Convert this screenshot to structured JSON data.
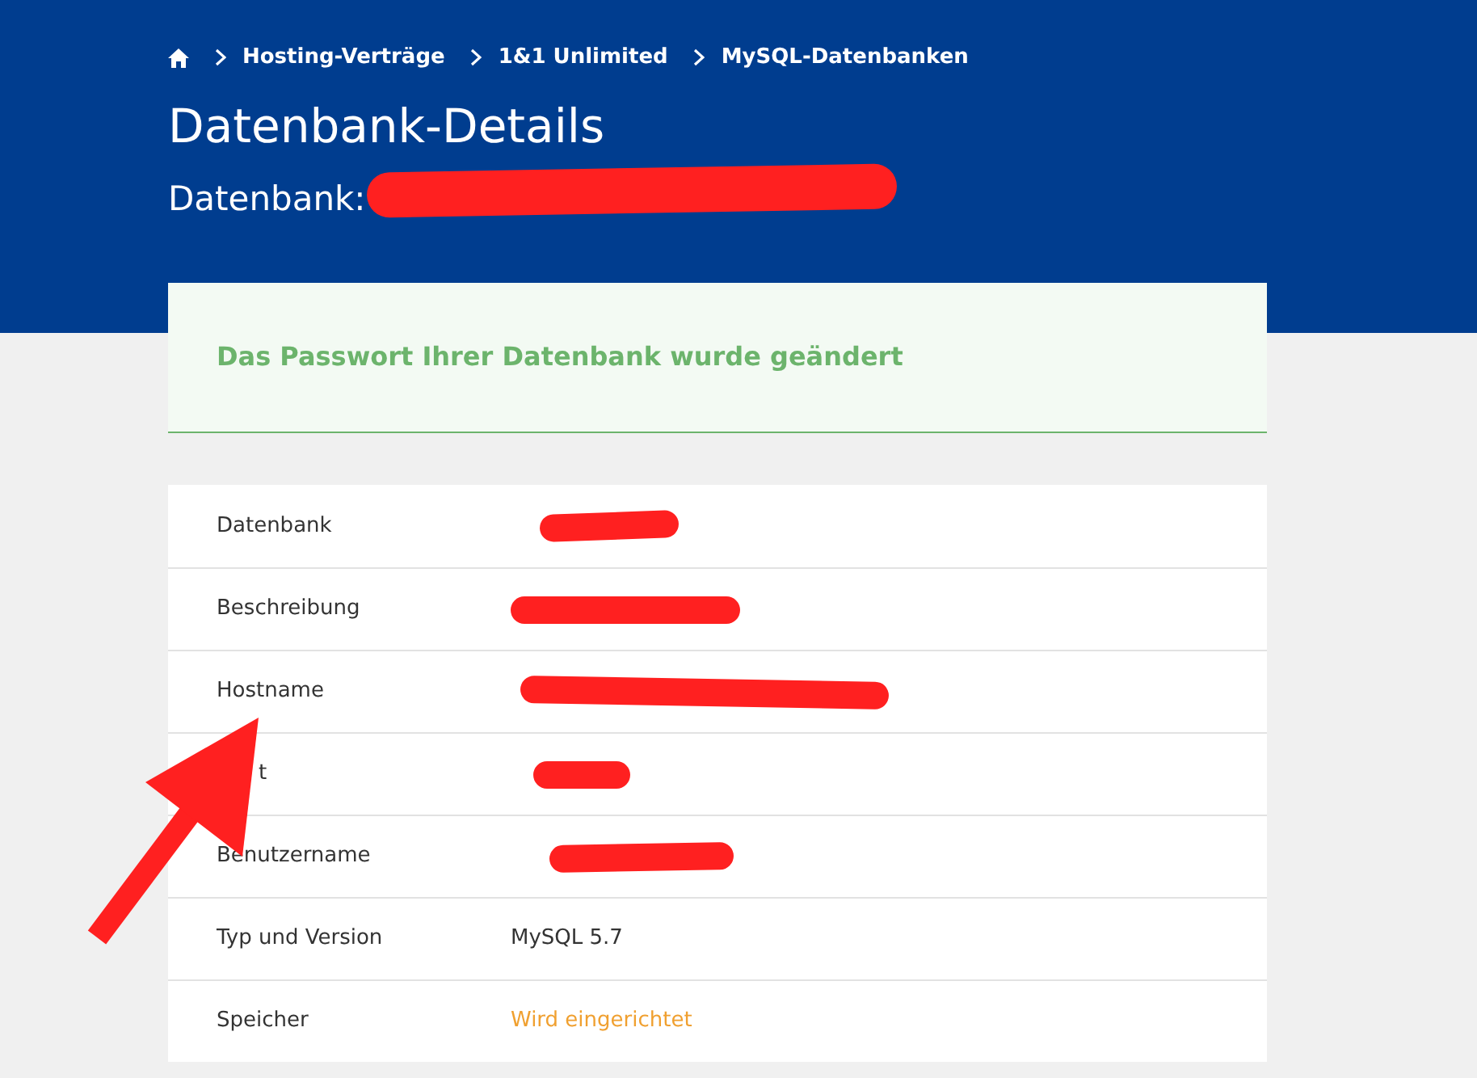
{
  "breadcrumb": [
    "Hosting-Verträge",
    "1&1 Unlimited",
    "MySQL-Datenbanken"
  ],
  "title": "Datenbank-Details",
  "subtitle": {
    "label": "Datenbank:",
    "redacted": true
  },
  "notice": {
    "kind": "success",
    "text": "Das Passwort Ihrer Datenbank wurde geändert"
  },
  "rows": [
    {
      "label": "Datenbank",
      "kind": "redacted"
    },
    {
      "label": "Beschreibung",
      "kind": "redacted"
    },
    {
      "label": "Hostname",
      "kind": "redacted"
    },
    {
      "label": "t",
      "kind": "redacted"
    },
    {
      "label": "Benutzername",
      "kind": "redacted"
    },
    {
      "label": "Typ und Version",
      "kind": "text",
      "value": "MySQL 5.7",
      "highlighted": false
    },
    {
      "label": "Speicher",
      "kind": "text",
      "value": "Wird eingerichtet",
      "highlighted": true
    }
  ],
  "annotation": {
    "kind": "arrow"
  }
}
